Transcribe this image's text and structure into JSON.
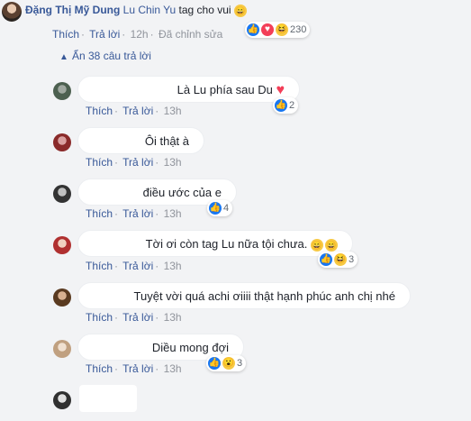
{
  "top_comment": {
    "author": "Đặng Thị Mỹ Dung",
    "mention": "Lu Chin Yu",
    "text": "tag cho vui",
    "like_label": "Thích",
    "reply_label": "Trả lời",
    "time": "12h",
    "edited": "Đã chỉnh sửa",
    "reaction_count": "230",
    "reactions": [
      "like-icon",
      "heart-icon",
      "haha-icon"
    ]
  },
  "collapse_label": "Ẩn 38 câu trả lời",
  "replies": [
    {
      "text": "Là Lu phía sau Du",
      "like_label": "Thích",
      "reply_label": "Trả lời",
      "time": "13h",
      "reaction_count": "2",
      "reactions": [
        "like-icon"
      ]
    },
    {
      "text": "Ôi thật à",
      "like_label": "Thích",
      "reply_label": "Trả lời",
      "time": "13h"
    },
    {
      "text": "điều ước của e",
      "like_label": "Thích",
      "reply_label": "Trả lời",
      "time": "13h",
      "reaction_count": "4",
      "reactions": [
        "like-icon"
      ]
    },
    {
      "text": "Tời ơi còn tag Lu nữa tội chưa.",
      "like_label": "Thích",
      "reply_label": "Trả lời",
      "time": "13h",
      "reaction_count": "3",
      "reactions": [
        "like-icon",
        "haha-icon"
      ]
    },
    {
      "text": "Tuyệt vời quá achi ơiiii thật hạnh phúc anh chị nhé",
      "like_label": "Thích",
      "reply_label": "Trả lời",
      "time": "13h"
    },
    {
      "text": "Diều mong đợi",
      "like_label": "Thích",
      "reply_label": "Trả lời",
      "time": "13h",
      "reaction_count": "3",
      "reactions": [
        "like-icon",
        "wow-icon"
      ]
    }
  ],
  "colors": {
    "link": "#385898",
    "like": "#1877f2",
    "heart": "#f33e58",
    "haha": "#f7c944",
    "background": "#f2f3f5"
  }
}
